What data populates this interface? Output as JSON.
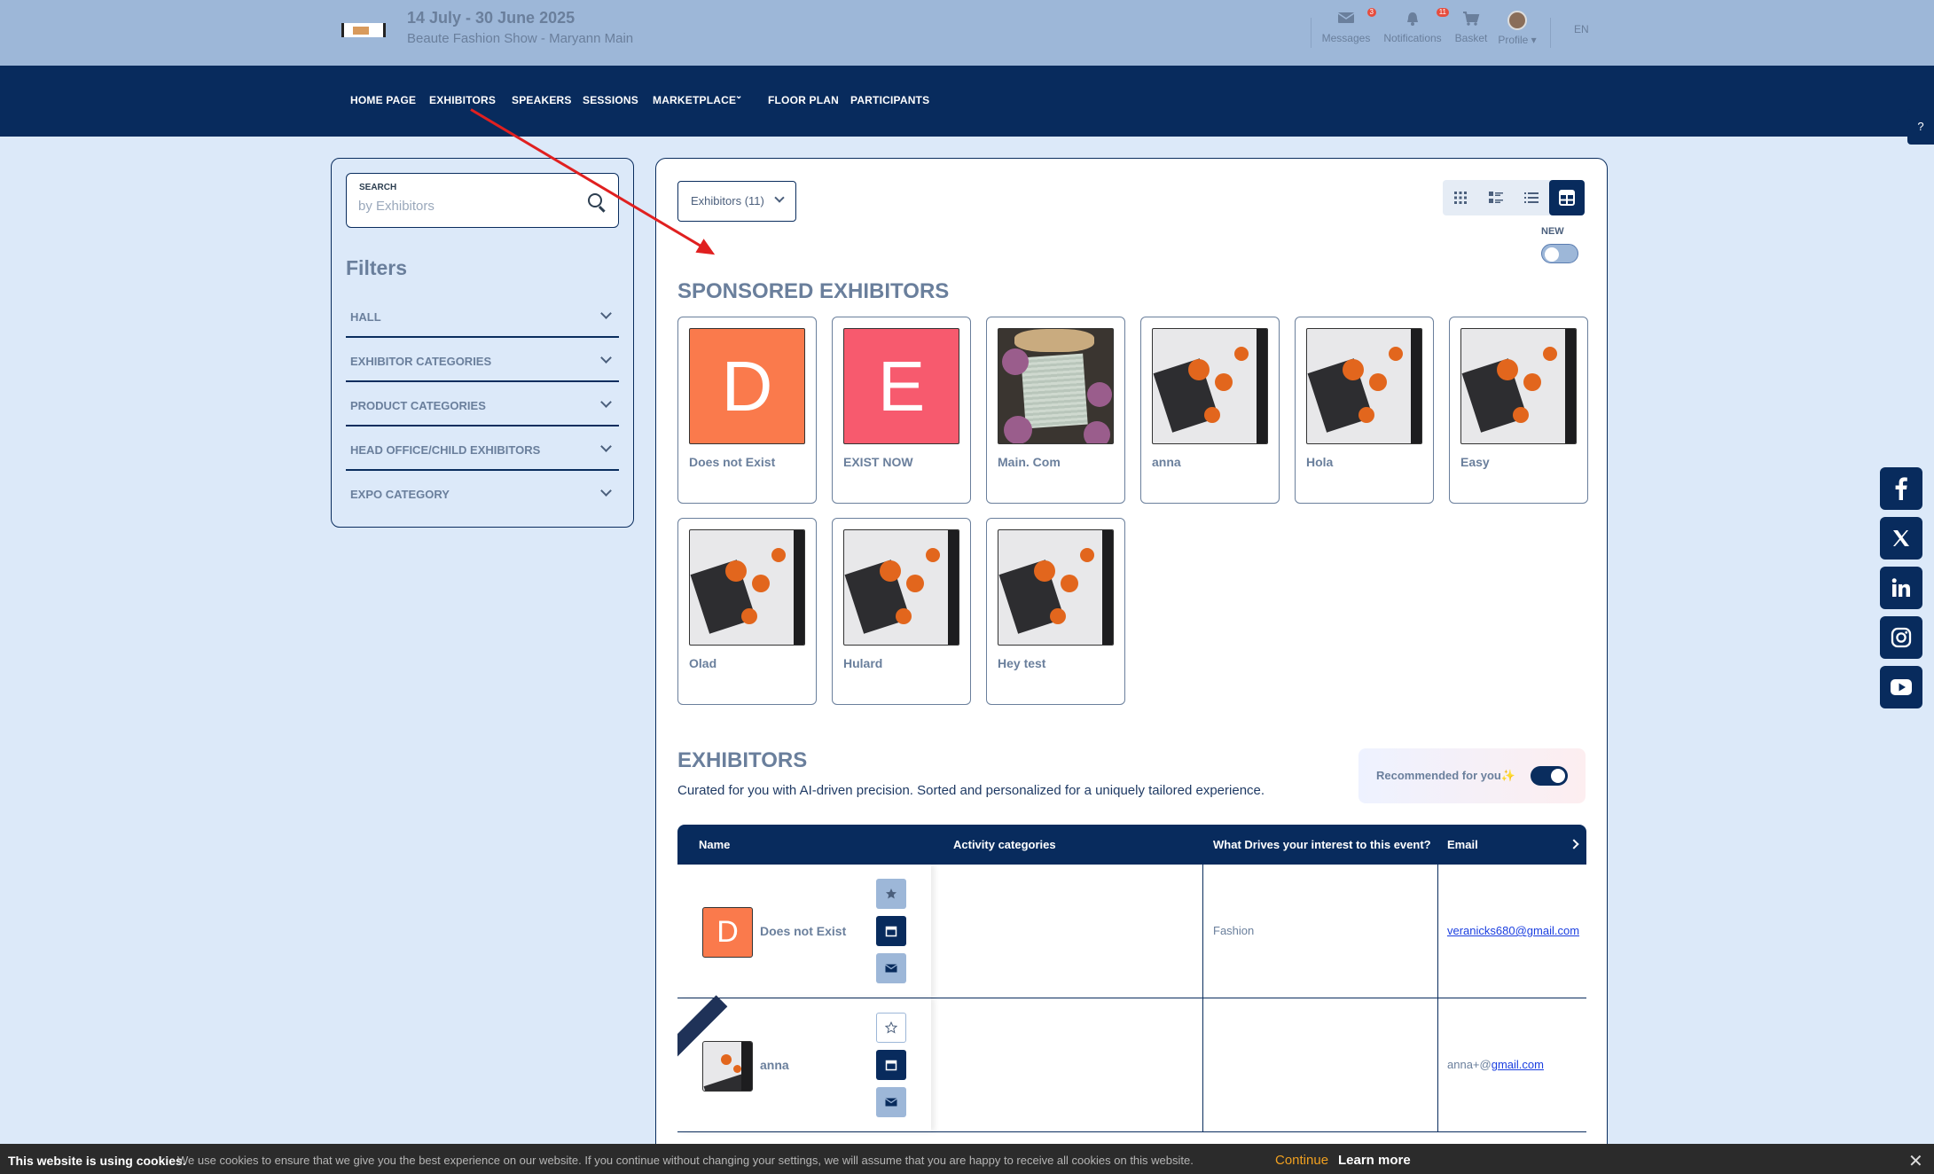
{
  "event": {
    "date": "14 July - 30 June 2025",
    "name": "Beaute Fashion Show - Maryann Main"
  },
  "topbar": {
    "messages": {
      "label": "Messages",
      "badge": "3",
      "icon": "envelope-icon"
    },
    "notifications": {
      "label": "Notifications",
      "badge": "11",
      "icon": "bell-icon"
    },
    "basket": {
      "label": "Basket",
      "icon": "cart-icon"
    },
    "profile": {
      "label": "Profile ▾",
      "icon": "avatar"
    },
    "language": "EN"
  },
  "nav": [
    "HOME PAGE",
    "EXHIBITORS",
    "SPEAKERS",
    "SESSIONS",
    "MARKETPLACE",
    "FLOOR PLAN",
    "PARTICIPANTS"
  ],
  "search": {
    "label": "SEARCH",
    "placeholder": "by Exhibitors"
  },
  "filters": {
    "title": "Filters",
    "items": [
      "HALL",
      "EXHIBITOR CATEGORIES",
      "PRODUCT CATEGORIES",
      "HEAD OFFICE/CHILD EXHIBITORS",
      "EXPO CATEGORY"
    ]
  },
  "toolbar": {
    "dropdown_label": "Exhibitors (11)",
    "new_label": "NEW",
    "new_toggle": false
  },
  "sponsored": {
    "title": "SPONSORED EXHIBITORS",
    "cards": [
      {
        "name": "Does not Exist",
        "letter": "D",
        "color": "#fa7a4c"
      },
      {
        "name": "EXIST NOW",
        "letter": "E",
        "color": "#f75a6e"
      },
      {
        "name": "Main. Com",
        "image": "frame"
      },
      {
        "name": "anna",
        "image": "pumpkin"
      },
      {
        "name": "Hola",
        "image": "pumpkin"
      },
      {
        "name": "Easy",
        "image": "pumpkin"
      },
      {
        "name": "Olad",
        "image": "pumpkin"
      },
      {
        "name": "Hulard",
        "image": "pumpkin"
      },
      {
        "name": "Hey test",
        "image": "pumpkin"
      }
    ]
  },
  "exhibitors": {
    "title": "EXHIBITORS",
    "subtitle": "Curated for you with AI-driven precision. Sorted and personalized for a uniquely tailored experience.",
    "recommended_label": "Recommended for you✨",
    "recommended_toggle": true,
    "columns": [
      "Name",
      "Activity categories",
      "What Drives your interest to this event?",
      "Email"
    ],
    "rows": [
      {
        "name": "Does not Exist",
        "activity": "",
        "interest": "Fashion",
        "email_prefix": "",
        "email_link": "veranicks680@gmail.com"
      },
      {
        "name": "anna",
        "activity": "",
        "interest": "",
        "email_prefix": "anna+@",
        "email_link": "gmail.com"
      }
    ]
  },
  "social": [
    "facebook-icon",
    "x-icon",
    "linkedin-icon",
    "instagram-icon",
    "youtube-icon"
  ],
  "cookie": {
    "title": "This website is using cookies.",
    "message": "We use cookies to ensure that we give you the best experience on our website. If you continue without changing your settings, we will assume that you are happy to receive all cookies on this website.",
    "continue": "Continue",
    "learn_more": "Learn more"
  },
  "colors": {
    "navy": "#082b5d",
    "background": "#dce9f9",
    "topbar": "#9db7d8",
    "annotation_arrow": "#e02020"
  }
}
